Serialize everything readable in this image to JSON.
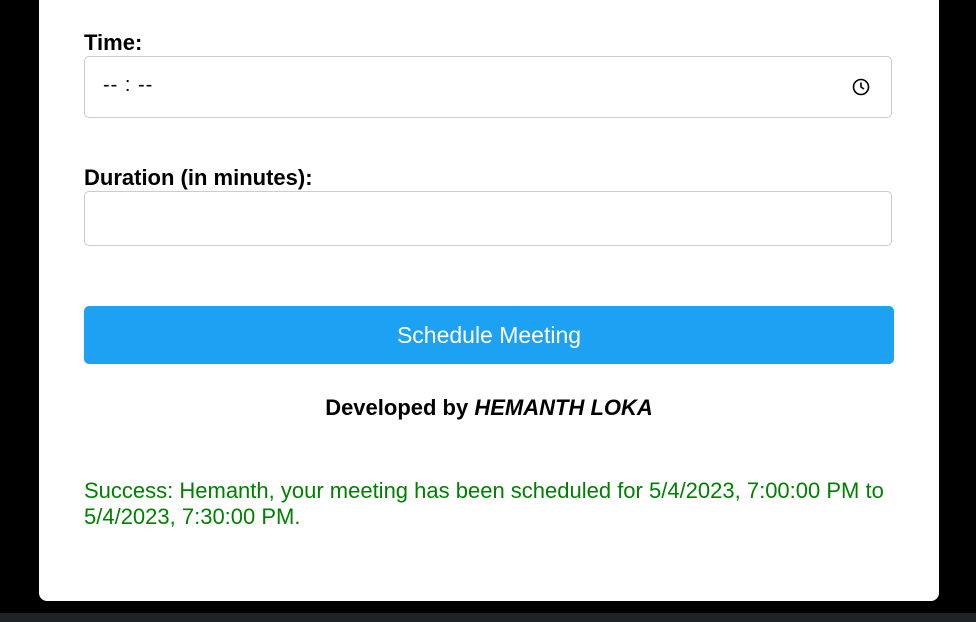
{
  "form": {
    "time_label": "Time:",
    "time_value": "-- : --",
    "time_icon": "clock-icon",
    "duration_label": "Duration (in minutes):",
    "duration_value": "",
    "submit_label": "Schedule Meeting"
  },
  "footer": {
    "developed_by": "Developed by",
    "author": "HEMANTH LOKA"
  },
  "status": {
    "message": "Success: Hemanth, your meeting has been scheduled for 5/4/2023, 7:00:00 PM to 5/4/2023, 7:30:00 PM."
  },
  "colors": {
    "accent": "#1da1f2",
    "success": "#008000"
  }
}
